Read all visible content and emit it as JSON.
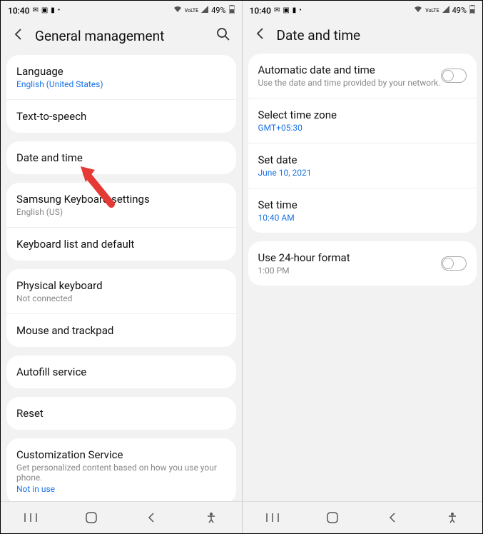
{
  "status": {
    "time": "10:40",
    "battery": "49%"
  },
  "screen1": {
    "title": "General management",
    "cards": [
      {
        "items": [
          {
            "title": "Language",
            "sub": "English (United States)",
            "subLink": true
          },
          {
            "title": "Text-to-speech"
          }
        ]
      },
      {
        "items": [
          {
            "title": "Date and time"
          }
        ]
      },
      {
        "items": [
          {
            "title": "Samsung Keyboard settings",
            "sub": "English (US)"
          },
          {
            "title": "Keyboard list and default"
          }
        ]
      },
      {
        "items": [
          {
            "title": "Physical keyboard",
            "sub": "Not connected"
          },
          {
            "title": "Mouse and trackpad"
          }
        ]
      },
      {
        "items": [
          {
            "title": "Autofill service"
          }
        ]
      },
      {
        "items": [
          {
            "title": "Reset"
          }
        ]
      },
      {
        "items": [
          {
            "title": "Customization Service",
            "sub": "Get personalized content based on how you use your phone.",
            "extra": "Not in use"
          }
        ]
      }
    ]
  },
  "screen2": {
    "title": "Date and time",
    "cards": [
      {
        "items": [
          {
            "title": "Automatic date and time",
            "sub": "Use the date and time provided by your network.",
            "toggle": true
          },
          {
            "title": "Select time zone",
            "sub": "GMT+05:30",
            "subLink": true
          },
          {
            "title": "Set date",
            "sub": "June 10, 2021",
            "subLink": true
          },
          {
            "title": "Set time",
            "sub": "10:40 AM",
            "subLink": true
          }
        ]
      },
      {
        "items": [
          {
            "title": "Use 24-hour format",
            "sub": "1:00 PM",
            "toggle": true
          }
        ]
      }
    ]
  }
}
